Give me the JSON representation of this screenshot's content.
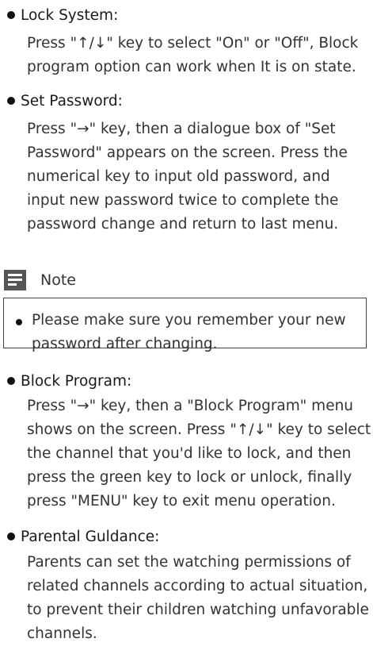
{
  "sections": [
    {
      "title": "Lock System",
      "suffix": ":",
      "body": "Press \"↑/↓\" key to select \"On\" or \"Off\", Block\nprogram option can work when It is on state."
    },
    {
      "title": "Set Password",
      "suffix": ":",
      "body": "Press \"→\" key, then a dialogue box of \"Set\nPassword\" appears on the screen. Press the\nnumerical key to input old password, and\ninput new password twice to complete the\npassword change and return to last menu."
    },
    {
      "title": "Block Program",
      "suffix": ":",
      "body": "Press \"→\" key, then a \"Block Program\" menu\nshows on the screen. Press \"↑/↓\" key to select\nthe channel that you'd like to lock, and then\npress the green key to lock or unlock, finally\npress \"MENU\" key to exit menu operation."
    },
    {
      "title": "Parental Guldance",
      "suffix": ":",
      "body": "Parents can set the watching permissions of\nrelated channels according to actual situation,\nto prevent their children watching unfavorable\nchannels."
    }
  ],
  "note": {
    "label": "Note",
    "icon": "note-icon",
    "text": "Please make sure you remember your new\npassword after changing."
  }
}
